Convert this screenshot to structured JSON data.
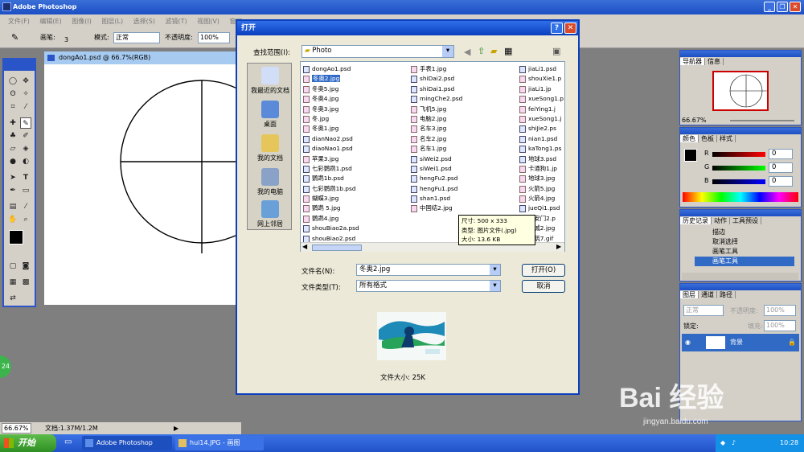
{
  "app": {
    "title": "Adobe Photoshop",
    "menu": [
      "文件(F)",
      "编辑(E)",
      "图像(I)",
      "图层(L)",
      "选择(S)",
      "滤镜(T)",
      "视图(V)",
      "窗口"
    ]
  },
  "options": {
    "brush_label": "画笔:",
    "brush_size": "3",
    "mode_label": "模式:",
    "mode_value": "正常",
    "opacity_label": "不透明度:",
    "opacity_value": "100%"
  },
  "document": {
    "title": "dongAo1.psd @ 66.7%(RGB)"
  },
  "statusbar": {
    "zoom": "66.67%",
    "doc": "文档:1.37M/1.2M"
  },
  "panels": {
    "navigator": {
      "tabs": [
        "导航器",
        "信息"
      ],
      "zoom": "66.67%"
    },
    "color": {
      "tabs": [
        "颜色",
        "色板",
        "样式"
      ],
      "r_label": "R",
      "g_label": "G",
      "b_label": "B",
      "r": "0",
      "g": "0",
      "b": "0"
    },
    "history": {
      "tabs": [
        "历史记录",
        "动作",
        "工具预设"
      ],
      "items": [
        "描边",
        "取消选择",
        "画笔工具",
        "画笔工具"
      ]
    },
    "layers": {
      "tabs": [
        "图层",
        "通道",
        "路径"
      ],
      "blend": "正常",
      "opacity_label": "不透明度:",
      "opacity": "100%",
      "lock_label": "锁定:",
      "fill_label": "填充:",
      "fill": "100%",
      "layer_name": "背景"
    }
  },
  "dialog": {
    "title": "打开",
    "lookin_label": "查找范围(I):",
    "lookin_value": "Photo",
    "places": [
      "我最近的文档",
      "桌面",
      "我的文档",
      "我的电脑",
      "网上邻居"
    ],
    "col1": [
      "dongAo1.psd",
      "冬奥2.jpg",
      "冬奥5.jpg",
      "冬奥4.jpg",
      "冬奥3.jpg",
      "冬.jpg",
      "冬奥1.jpg",
      "dianNao2.psd",
      "diaoNao1.psd",
      "苹果3.jpg",
      "七彩鹦鹉1.psd",
      "鹦鹉1b.psd",
      "七彩鹦鹉1b.psd",
      "蝴蝶3.jpg",
      "鹦鹉 5.jpg",
      "鹦鹉4.jpg",
      "shouBiao2a.psd",
      "shouBiao2.psd"
    ],
    "col2": [
      "手表1.jpg",
      "shiDai2.psd",
      "shiDai1.psd",
      "mingChe2.psd",
      "飞机5.jpg",
      "电脑2.jpg",
      "名车3.jpg",
      "名车2.jpg",
      "名车1.jpg",
      "siWei2.psd",
      "siWei1.psd",
      "hengFu2.psd",
      "hengFu1.psd",
      "shan1.psd",
      "中国结2.jpg"
    ],
    "col3": [
      "jiaLi1.psd",
      "shouXie1.p",
      "jiaLi1.jp",
      "xueSong1.p",
      "feiYing1.j",
      "xueSong1.j",
      "shiJie2.ps",
      "nian1.psd",
      "kaTong1.ps",
      "地球3.psd",
      "卡通狗1.jp",
      "地球3.jpg",
      "火箭5.jpg",
      "火箭4.jpg",
      "jueQi1.psd",
      "天安门2.p",
      "长城2.jpg",
      "建筑7.gif"
    ],
    "tooltip": [
      "尺寸: 500 x 333",
      "类型: 图片文件(.jpg)",
      "大小: 13.6 KB"
    ],
    "filename_label": "文件名(N):",
    "filename_value": "冬奥2.jpg",
    "filetype_label": "文件类型(T):",
    "filetype_value": "所有格式",
    "open_button": "打开(O)",
    "cancel_button": "取消",
    "filesize": "文件大小: 25K"
  },
  "taskbar": {
    "start": "开始",
    "tasks": [
      "Adobe Photoshop",
      "hui14.JPG - 画图"
    ],
    "time": "10:28"
  },
  "watermark": {
    "brand": "Bai 经验",
    "url": "jingyan.baidu.com"
  },
  "badge": "24"
}
